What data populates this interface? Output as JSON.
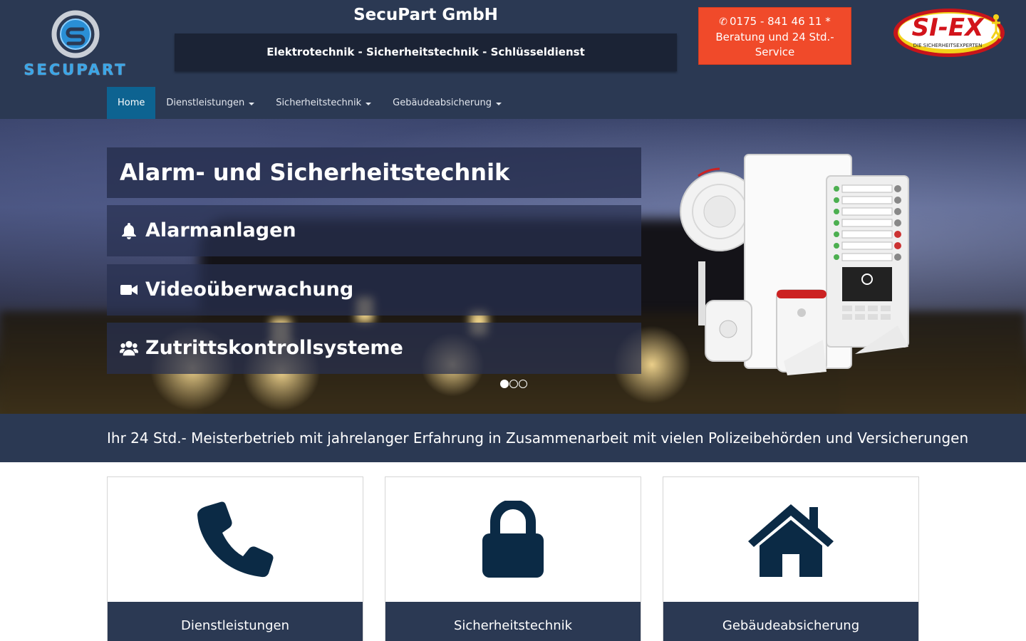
{
  "header": {
    "logo_text": "SECUPART",
    "company_name": "SecuPart GmbH",
    "tagline": "Elektrotechnik - Sicherheitstechnik - Schlüsseldienst",
    "cta": {
      "phone": "0175 - 841 46 11 *",
      "line2": "Beratung und 24 Std.-",
      "line3": "Service"
    },
    "partner_logo_text": "SI-EX",
    "partner_logo_subtext": "DIE SICHERHEITSEXPERTEN"
  },
  "nav": {
    "items": [
      {
        "label": "Home",
        "active": true
      },
      {
        "label": "Dienstleistungen",
        "dropdown": true
      },
      {
        "label": "Sicherheitstechnik",
        "dropdown": true
      },
      {
        "label": "Gebäudeabsicherung",
        "dropdown": true
      }
    ]
  },
  "hero": {
    "title": "Alarm- und Sicherheitstechnik",
    "items": [
      {
        "label": "Alarmanlagen",
        "icon": "bell-icon"
      },
      {
        "label": "Videoüberwachung",
        "icon": "video-camera-icon"
      },
      {
        "label": "Zutrittskontrollsysteme",
        "icon": "users-icon"
      }
    ],
    "slides": 3,
    "active_slide": 1
  },
  "banner": {
    "text": "Ihr 24 Std.- Meisterbetrieb mit jahrelanger Erfahrung in Zusammenarbeit mit vielen Polizeibehörden und Versicherungen"
  },
  "cards": [
    {
      "label": "Dienstleistungen",
      "icon": "phone-icon"
    },
    {
      "label": "Sicherheitstechnik",
      "icon": "lock-icon"
    },
    {
      "label": "Gebäudeabsicherung",
      "icon": "home-icon"
    }
  ],
  "colors": {
    "header_bg": "#2b3953",
    "nav_active": "#0d6391",
    "cta_bg": "#f04a2a",
    "icon_color": "#0b2a45"
  }
}
